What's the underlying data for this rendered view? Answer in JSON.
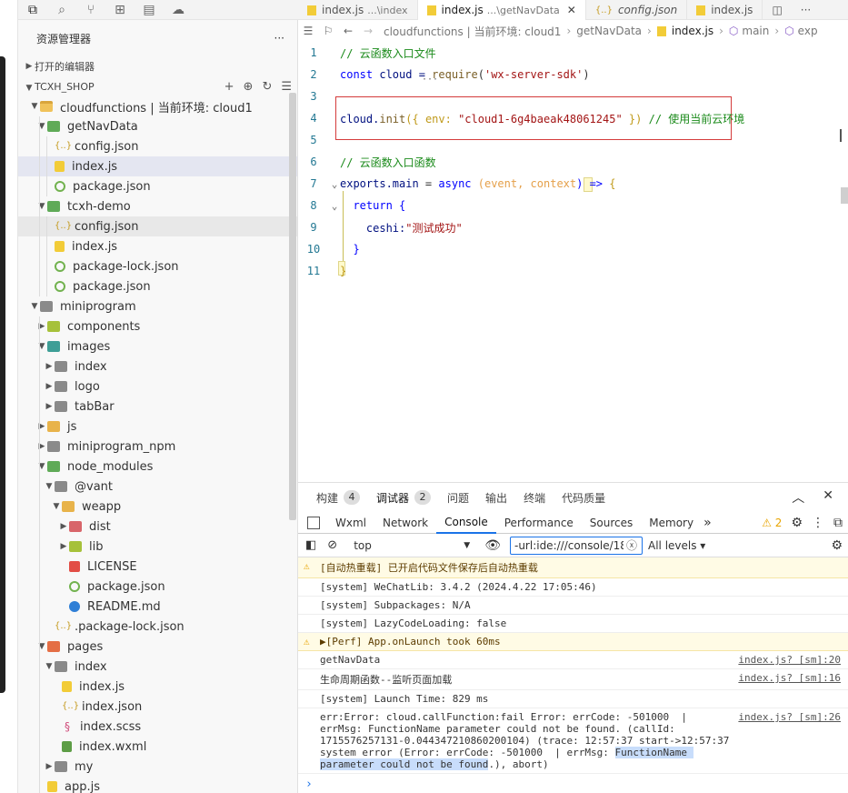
{
  "explorer": {
    "title": "资源管理器",
    "more": "···",
    "open_editors": "打开的编辑器",
    "project": "TCXH_SHOP",
    "tree": [
      {
        "label": "cloudfunctions | 当前环境: cloud1",
        "icon": "folder-open"
      },
      {
        "label": "getNavData",
        "icon": "folder-green"
      },
      {
        "label": "config.json",
        "icon": "json"
      },
      {
        "label": "index.js",
        "icon": "js"
      },
      {
        "label": "package.json",
        "icon": "pkg"
      },
      {
        "label": "tcxh-demo",
        "icon": "folder-green"
      },
      {
        "label": "config.json",
        "icon": "json"
      },
      {
        "label": "index.js",
        "icon": "js"
      },
      {
        "label": "package-lock.json",
        "icon": "pkg"
      },
      {
        "label": "package.json",
        "icon": "pkg"
      },
      {
        "label": "miniprogram",
        "icon": "folder-gray"
      },
      {
        "label": "components",
        "icon": "folder-lime"
      },
      {
        "label": "images",
        "icon": "folder-teal"
      },
      {
        "label": "index",
        "icon": "folder-gray"
      },
      {
        "label": "logo",
        "icon": "folder-gray"
      },
      {
        "label": "tabBar",
        "icon": "folder-gray"
      },
      {
        "label": "js",
        "icon": "folder"
      },
      {
        "label": "miniprogram_npm",
        "icon": "folder-gray"
      },
      {
        "label": "node_modules",
        "icon": "folder-green"
      },
      {
        "label": "@vant",
        "icon": "folder-gray"
      },
      {
        "label": "weapp",
        "icon": "folder"
      },
      {
        "label": "dist",
        "icon": "folder-red"
      },
      {
        "label": "lib",
        "icon": "folder-lime"
      },
      {
        "label": "LICENSE",
        "icon": "lic"
      },
      {
        "label": "package.json",
        "icon": "pkg"
      },
      {
        "label": "README.md",
        "icon": "info"
      },
      {
        "label": ".package-lock.json",
        "icon": "json"
      },
      {
        "label": "pages",
        "icon": "folder-pages"
      },
      {
        "label": "index",
        "icon": "folder-gray"
      },
      {
        "label": "index.js",
        "icon": "js"
      },
      {
        "label": "index.json",
        "icon": "json"
      },
      {
        "label": "index.scss",
        "icon": "scss"
      },
      {
        "label": "index.wxml",
        "icon": "wxml"
      },
      {
        "label": "my",
        "icon": "folder-gray"
      },
      {
        "label": "app.js",
        "icon": "js"
      }
    ]
  },
  "tabs": [
    {
      "name": "index.js",
      "sub": "...\\index"
    },
    {
      "name": "index.js",
      "sub": "...\\getNavData",
      "close": "✕"
    },
    {
      "name": "config.json",
      "sub": ""
    },
    {
      "name": "index.js",
      "sub": ""
    }
  ],
  "breadcrumb": {
    "parts": [
      "cloudfunctions | 当前环境: cloud1",
      "getNavData",
      "index.js",
      "main",
      "exp"
    ]
  },
  "editor": {
    "line_numbers": [
      "1",
      "2",
      "3",
      "4",
      "5",
      "6",
      "7",
      "8",
      "9",
      "10",
      "11"
    ],
    "l1": "// 云函数入口文件",
    "l2_kw": "const",
    "l2_var": " cloud = ",
    "l2_fn": "require",
    "l2_open": "(",
    "l2_str": "'wx-server-sdk'",
    "l2_close": ")",
    "l2_dots": "···",
    "l4_a": "cloud.",
    "l4_fn": "init",
    "l4_b": "({ env: ",
    "l4_str": "\"cloud1-6g4baeak48061245\"",
    "l4_c": " }) ",
    "l4_cmt": "// 使用当前云环境",
    "l6": "// 云函数入口函数",
    "l7_a": "exports.",
    "l7_b": "main",
    "l7_c": " = ",
    "l7_kw": "async",
    "l7_d": " (",
    "l7_p1": "event",
    "l7_e": ", ",
    "l7_p2": "context",
    "l7_f": ") => ",
    "l7_g": "{",
    "l8_kw": "return",
    "l8_b": " {",
    "l9_a": "ceshi:",
    "l9_str": "\"测试成功\"",
    "l10": "}",
    "l11": "}"
  },
  "panel": {
    "tabs": [
      {
        "label": "构建",
        "badge": "4"
      },
      {
        "label": "调试器",
        "badge": "2"
      },
      {
        "label": "问题",
        "badge": ""
      },
      {
        "label": "输出",
        "badge": ""
      },
      {
        "label": "终端",
        "badge": ""
      },
      {
        "label": "代码质量",
        "badge": ""
      }
    ],
    "collapse": "︿",
    "close": "✕"
  },
  "devtools": {
    "tabs": [
      "Wxml",
      "Network",
      "Console",
      "Performance",
      "Sources",
      "Memory"
    ],
    "more": "»",
    "warn_count": "⚠ 2",
    "context": "top",
    "filter_value": "-url:ide:///console/18",
    "levels": "All levels ▾"
  },
  "console": [
    {
      "type": "warn",
      "text": "[自动热重载] 已开启代码文件保存后自动热重载",
      "src": ""
    },
    {
      "type": "log",
      "text": "[system] WeChatLib: 3.4.2 (2024.4.22 17:05:46)",
      "src": ""
    },
    {
      "type": "log",
      "text": "[system] Subpackages: N/A",
      "src": ""
    },
    {
      "type": "log",
      "text": "[system] LazyCodeLoading: false",
      "src": ""
    },
    {
      "type": "warn",
      "text": "▶[Perf] App.onLaunch took 60ms",
      "src": ""
    },
    {
      "type": "log",
      "text": "getNavData",
      "src": "index.js? [sm]:20"
    },
    {
      "type": "log",
      "text": "生命周期函数--监听页面加载",
      "src": "index.js? [sm]:16"
    },
    {
      "type": "log",
      "text": "[system] Launch Time: 829 ms",
      "src": ""
    },
    {
      "type": "error",
      "text_a": "err:Error: cloud.callFunction:fail Error: errCode: -501000  |  errMsg: FunctionName parameter could not be found. (callId: 1715576257131-0.044347210860200104) (trace: 12:57:37 start->12:57:37 system error (Error: errCode: -501000  | errMsg: ",
      "text_hl": "FunctionName parameter could not be found",
      "text_b": ".), abort)",
      "src": "index.js? [sm]:26"
    }
  ],
  "prompt": "›"
}
